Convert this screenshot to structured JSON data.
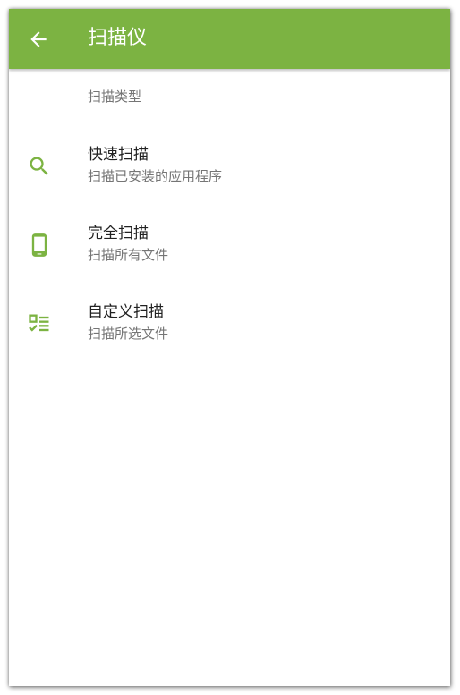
{
  "app_bar": {
    "title": "扫描仪",
    "back_icon": "arrow-back-icon",
    "color": "#7cb342"
  },
  "section": {
    "header": "扫描类型"
  },
  "items": [
    {
      "label": "快速扫描",
      "description": "扫描已安装的应用程序",
      "icon": "search-icon"
    },
    {
      "label": "完全扫描",
      "description": "扫描所有文件",
      "icon": "phone-icon"
    },
    {
      "label": "自定义扫描",
      "description": "扫描所选文件",
      "icon": "checklist-icon"
    }
  ],
  "colors": {
    "accent": "#7cb342",
    "primary_text": "#212121",
    "secondary_text": "#757575"
  }
}
